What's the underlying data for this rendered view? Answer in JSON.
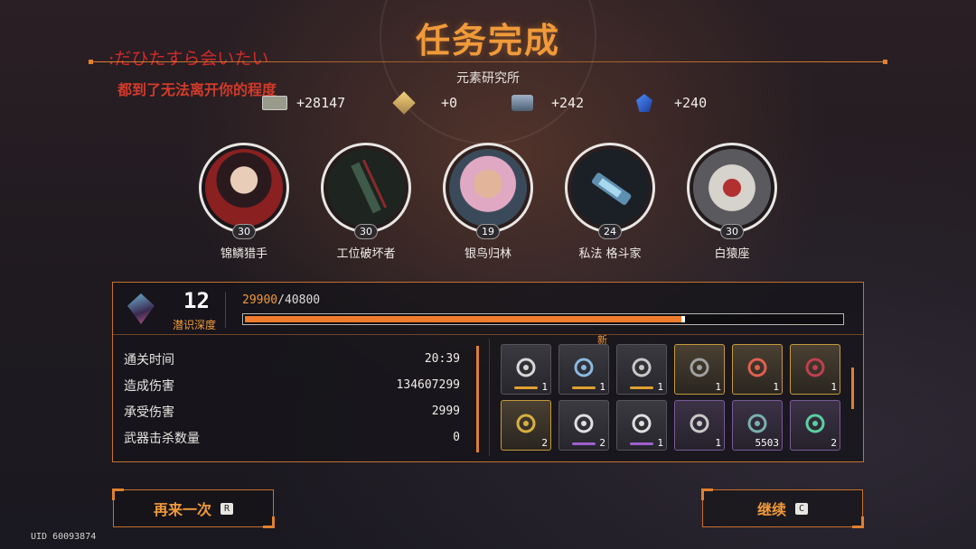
{
  "header": {
    "title": "任务完成",
    "subtitle": "元素研究所",
    "lyric_line1": ":だひたすら会いたい",
    "lyric_line2": "都到了无法离开你的程度"
  },
  "rewards": [
    {
      "icon": "cash-icon",
      "value": "+28147"
    },
    {
      "icon": "gold-cube-icon",
      "value": "+0"
    },
    {
      "icon": "supply-box-icon",
      "value": "+242"
    },
    {
      "icon": "blue-crystal-icon",
      "value": "+240"
    }
  ],
  "characters": [
    {
      "name": "锦鳞猎手",
      "level": "30"
    },
    {
      "name": "工位破坏者",
      "level": "30"
    },
    {
      "name": "银鸟归林",
      "level": "19"
    },
    {
      "name": "私法 格斗家",
      "level": "24"
    },
    {
      "name": "白猿座",
      "level": "30"
    }
  ],
  "depth": {
    "value": "12",
    "label": "潜识深度"
  },
  "experience": {
    "current": "29900",
    "separator": "/",
    "total": "40800",
    "progress": 0.733
  },
  "stats": [
    {
      "label": "通关时间",
      "value": "20:39"
    },
    {
      "label": "造成伤害",
      "value": "134607299"
    },
    {
      "label": "承受伤害",
      "value": "2999"
    },
    {
      "label": "武器击杀数量",
      "value": "0"
    }
  ],
  "items": [
    {
      "icon": "burst-emblem-icon",
      "qty": "1",
      "rarity": "gold-bar",
      "frame": "plain",
      "badge": ""
    },
    {
      "icon": "anchor-emblem-icon",
      "qty": "1",
      "rarity": "gold-bar",
      "frame": "plain",
      "badge": "新"
    },
    {
      "icon": "ring-emblem-icon",
      "qty": "1",
      "rarity": "gold-bar",
      "frame": "plain",
      "badge": ""
    },
    {
      "icon": "blade-part-icon",
      "qty": "1",
      "rarity": "",
      "frame": "gold",
      "badge": ""
    },
    {
      "icon": "core-module-icon",
      "qty": "1",
      "rarity": "",
      "frame": "gold",
      "badge": ""
    },
    {
      "icon": "chip-module-icon",
      "qty": "1",
      "rarity": "",
      "frame": "gold",
      "badge": ""
    },
    {
      "icon": "battery-icon",
      "qty": "2",
      "rarity": "",
      "frame": "gold",
      "badge": ""
    },
    {
      "icon": "sniper-scope-icon",
      "qty": "2",
      "rarity": "purple-bar",
      "frame": "plain",
      "badge": ""
    },
    {
      "icon": "rifle-mod-icon",
      "qty": "1",
      "rarity": "purple-bar",
      "frame": "plain",
      "badge": ""
    },
    {
      "icon": "claw-part-icon",
      "qty": "1",
      "rarity": "",
      "frame": "purple",
      "badge": ""
    },
    {
      "icon": "gear-ring-icon",
      "qty": "5503",
      "rarity": "",
      "frame": "purple",
      "badge": ""
    },
    {
      "icon": "canister-icon",
      "qty": "2",
      "rarity": "",
      "frame": "purple",
      "badge": ""
    }
  ],
  "buttons": {
    "retry": {
      "label": "再来一次",
      "key": "R"
    },
    "continue": {
      "label": "继续",
      "key": "C"
    }
  },
  "uid": "UID 60093874",
  "colors": {
    "accent": "#f09a3a",
    "frame": "#c8702e",
    "lyric": "#d22a2a"
  }
}
